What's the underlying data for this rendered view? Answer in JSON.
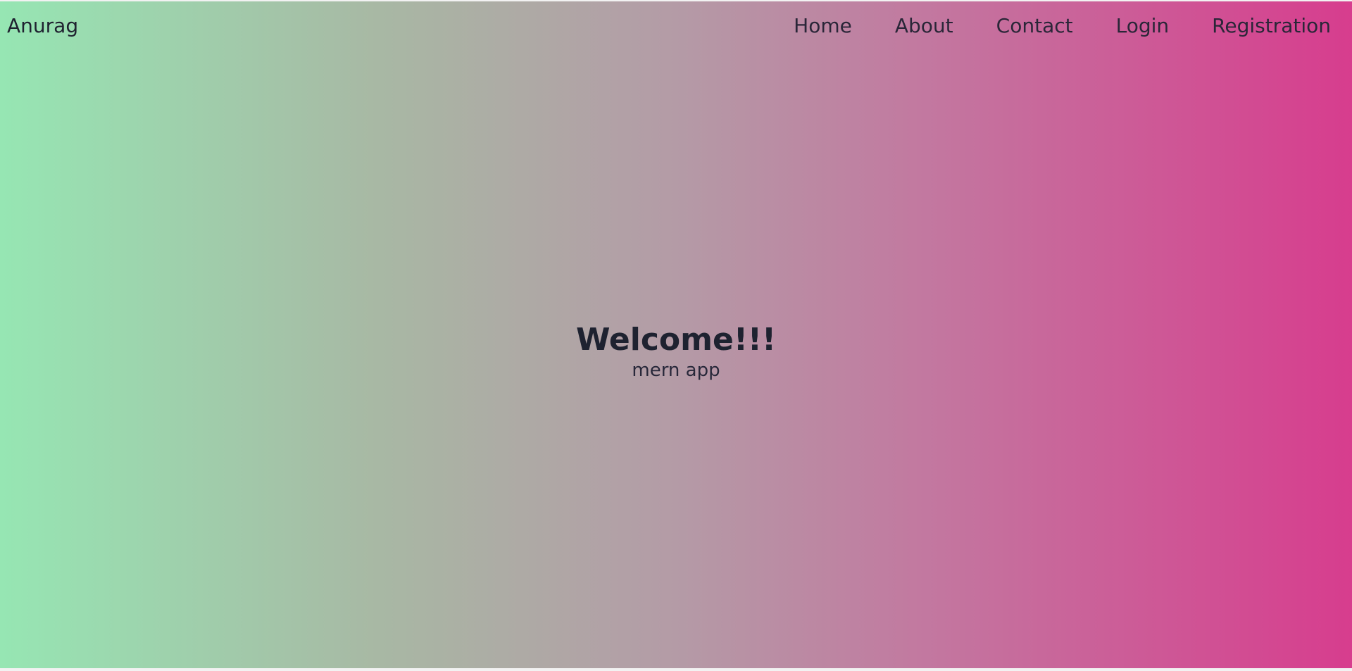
{
  "navbar": {
    "brand": "Anurag",
    "links": [
      {
        "label": "Home"
      },
      {
        "label": "About"
      },
      {
        "label": "Contact"
      },
      {
        "label": "Login"
      },
      {
        "label": "Registration"
      }
    ]
  },
  "hero": {
    "title": "Welcome!!!",
    "subtitle": "mern app"
  },
  "colors": {
    "gradient_start": "#96e6b3",
    "gradient_end": "#d73d8e",
    "text": "#1e2230"
  }
}
